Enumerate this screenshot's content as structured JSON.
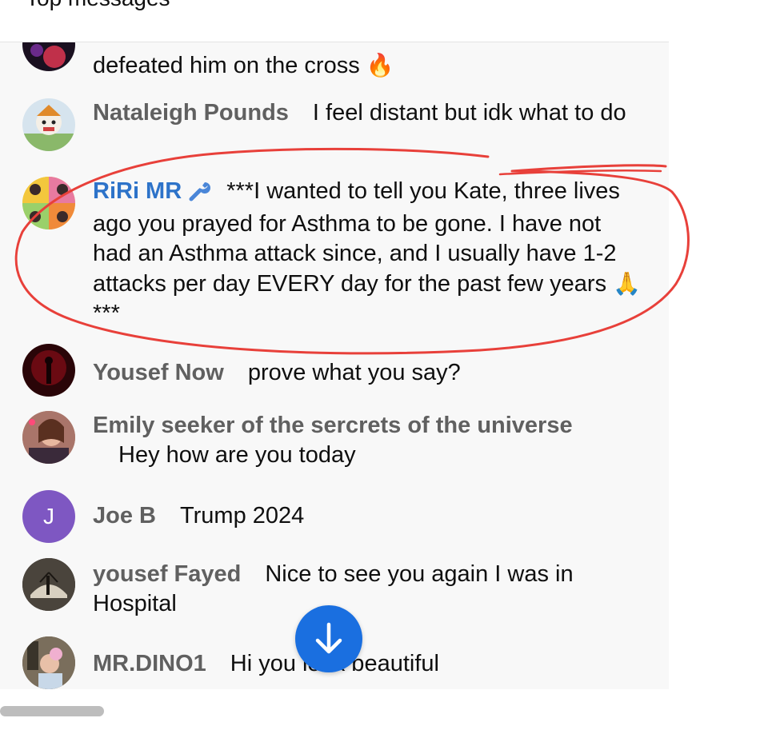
{
  "header": {
    "title": "Top messages"
  },
  "messages": [
    {
      "author": "",
      "text": "defeated him on the cross",
      "emoji": "🔥"
    },
    {
      "author": "Nataleigh Pounds",
      "text": "I feel distant but idk what to do"
    },
    {
      "author": "RiRi MR",
      "badge": "wrench-icon",
      "text": "***I wanted to tell you Kate, three lives ago you prayed for Asthma to be gone. I have not had an Asthma attack since, and I usually have 1-2 attacks per day EVERY day for the past few years",
      "emoji": "🙏",
      "suffix": "***"
    },
    {
      "author": "Yousef Now",
      "text": "prove what you say?"
    },
    {
      "author": "Emily seeker of the sercrets of the universe",
      "text": "Hey how are you today"
    },
    {
      "author": "Joe B",
      "avatar_letter": "J",
      "text": "Trump 2024"
    },
    {
      "author": "yousef Fayed",
      "text": "Nice to see you again I was in Hospital"
    },
    {
      "author": "MR.DINO1",
      "text": "Hi you look beautiful"
    }
  ],
  "colors": {
    "author_gray": "#606060",
    "moderator_blue": "#2d73c9",
    "scroll_button": "#1a6fe0",
    "annotation_red": "#e8403a",
    "joe_avatar": "#7e57c2"
  },
  "scroll_button": {
    "icon": "arrow-down-icon"
  }
}
